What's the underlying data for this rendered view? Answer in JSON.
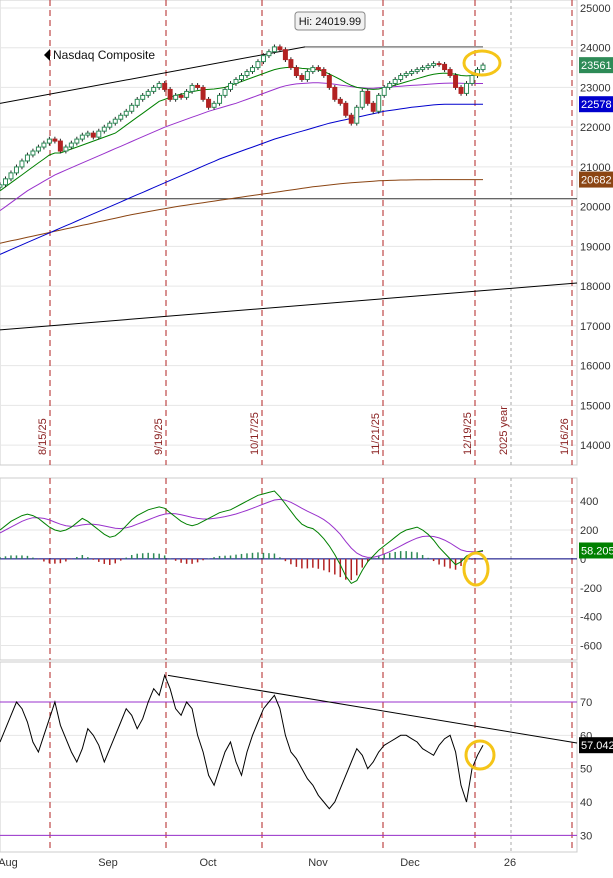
{
  "title": "Nasdaq Composite",
  "high_label": "Hi: 24019.99",
  "colors": {
    "price_line": "#000000",
    "sma20": "#008000",
    "sma50": "#9932cc",
    "sma100": "#0000cd",
    "sma200": "#8b4513",
    "vline": "#b22222",
    "highlight": "#f5c518",
    "up_candle": "#2e8b57",
    "down_candle": "#b22222",
    "macd": "#008000",
    "signal": "#9932cc",
    "rsi": "#000000",
    "rsi_band": "#9932cc"
  },
  "chart_data": [
    {
      "type": "line",
      "name": "price-panel",
      "y_ticks": [
        14000,
        15000,
        16000,
        17000,
        18000,
        19000,
        20000,
        21000,
        22000,
        23000,
        24000,
        25000
      ],
      "ylim": [
        13500,
        25200
      ],
      "value_badges": [
        {
          "value": "23561",
          "color": "#2e8b57"
        },
        {
          "value": "22578",
          "color": "#0000cd"
        },
        {
          "value": "20682",
          "color": "#8b4513"
        }
      ],
      "vertical_dates": [
        "8/15/25",
        "9/19/25",
        "10/17/25",
        "11/21/25",
        "12/19/25",
        "2025 year",
        "1/16/26"
      ],
      "series": [
        {
          "key": "close",
          "values": [
            20550,
            20700,
            20850,
            21000,
            21150,
            21300,
            21400,
            21500,
            21600,
            21700,
            21650,
            21400,
            21500,
            21600,
            21700,
            21800,
            21850,
            21750,
            21900,
            22000,
            22100,
            22200,
            22300,
            22400,
            22550,
            22700,
            22800,
            22900,
            23000,
            23100,
            22950,
            22700,
            22800,
            22750,
            22900,
            23050,
            23000,
            22700,
            22500,
            22600,
            22800,
            22950,
            23100,
            23200,
            23300,
            23400,
            23500,
            23650,
            23800,
            23900,
            24020,
            23950,
            23700,
            23500,
            23300,
            23200,
            23400,
            23500,
            23450,
            23300,
            23000,
            22700,
            22600,
            22300,
            22100,
            22500,
            22900,
            22600,
            22400,
            22800,
            23000,
            23100,
            23200,
            23300,
            23350,
            23400,
            23450,
            23500,
            23550,
            23600,
            23580,
            23450,
            23300,
            23000,
            22850,
            23100,
            23300,
            23450,
            23561
          ]
        },
        {
          "key": "sma20",
          "values": [
            20400,
            20500,
            20600,
            20700,
            20800,
            20900,
            21000,
            21100,
            21200,
            21300,
            21350,
            21350,
            21400,
            21450,
            21500,
            21550,
            21600,
            21650,
            21700,
            21750,
            21800,
            21850,
            21950,
            22050,
            22150,
            22250,
            22350,
            22450,
            22550,
            22650,
            22700,
            22750,
            22800,
            22830,
            22860,
            22890,
            22920,
            22940,
            22950,
            22960,
            22980,
            23000,
            23050,
            23100,
            23150,
            23200,
            23250,
            23300,
            23350,
            23400,
            23450,
            23480,
            23500,
            23510,
            23500,
            23480,
            23470,
            23460,
            23440,
            23400,
            23340,
            23270,
            23200,
            23120,
            23050,
            23000,
            22980,
            22960,
            22950,
            22960,
            22990,
            23020,
            23060,
            23100,
            23140,
            23180,
            23220,
            23260,
            23300,
            23330,
            23350,
            23360,
            23350,
            23330,
            23300,
            23290,
            23300,
            23320,
            23340
          ]
        },
        {
          "key": "sma50",
          "values": [
            19900,
            20000,
            20100,
            20200,
            20300,
            20400,
            20480,
            20560,
            20640,
            20720,
            20800,
            20860,
            20920,
            20980,
            21040,
            21100,
            21160,
            21220,
            21280,
            21340,
            21400,
            21460,
            21520,
            21580,
            21640,
            21700,
            21760,
            21820,
            21880,
            21940,
            22000,
            22050,
            22100,
            22150,
            22200,
            22250,
            22300,
            22350,
            22400,
            22440,
            22480,
            22520,
            22560,
            22600,
            22650,
            22700,
            22750,
            22800,
            22850,
            22900,
            22950,
            23000,
            23040,
            23070,
            23090,
            23100,
            23110,
            23120,
            23120,
            23110,
            23100,
            23080,
            23060,
            23040,
            23020,
            23000,
            22990,
            22980,
            22980,
            22990,
            23000,
            23010,
            23020,
            23030,
            23040,
            23050,
            23060,
            23070,
            23080,
            23090,
            23100,
            23105,
            23110,
            23110,
            23105,
            23100,
            23100,
            23100,
            23100
          ]
        },
        {
          "key": "sma100",
          "values": [
            18800,
            18860,
            18920,
            18980,
            19040,
            19100,
            19160,
            19220,
            19280,
            19340,
            19400,
            19460,
            19520,
            19580,
            19640,
            19700,
            19760,
            19820,
            19880,
            19940,
            20000,
            20060,
            20120,
            20180,
            20240,
            20300,
            20360,
            20420,
            20480,
            20540,
            20600,
            20660,
            20720,
            20780,
            20840,
            20900,
            20960,
            21020,
            21080,
            21140,
            21200,
            21250,
            21300,
            21350,
            21400,
            21450,
            21500,
            21550,
            21600,
            21650,
            21700,
            21740,
            21780,
            21820,
            21860,
            21900,
            21940,
            21980,
            22020,
            22060,
            22100,
            22130,
            22160,
            22190,
            22220,
            22250,
            22280,
            22310,
            22340,
            22370,
            22400,
            22420,
            22440,
            22460,
            22480,
            22500,
            22515,
            22530,
            22545,
            22560,
            22570,
            22575,
            22578,
            22578,
            22578,
            22578,
            22578,
            22578,
            22578
          ]
        },
        {
          "key": "sma200",
          "values": [
            19080,
            19110,
            19140,
            19170,
            19200,
            19230,
            19260,
            19290,
            19320,
            19350,
            19380,
            19410,
            19440,
            19470,
            19500,
            19530,
            19560,
            19590,
            19620,
            19650,
            19680,
            19710,
            19740,
            19770,
            19800,
            19825,
            19850,
            19875,
            19900,
            19925,
            19950,
            19975,
            20000,
            20020,
            20040,
            20060,
            20080,
            20100,
            20120,
            20140,
            20160,
            20180,
            20200,
            20220,
            20240,
            20260,
            20280,
            20300,
            20320,
            20340,
            20360,
            20380,
            20400,
            20420,
            20440,
            20460,
            20480,
            20500,
            20515,
            20530,
            20545,
            20560,
            20575,
            20590,
            20600,
            20610,
            20620,
            20630,
            20640,
            20650,
            20655,
            20660,
            20665,
            20670,
            20672,
            20674,
            20676,
            20678,
            20679,
            20680,
            20681,
            20682,
            20682,
            20682,
            20682,
            20682,
            20682,
            20682,
            20682
          ]
        }
      ]
    },
    {
      "type": "line",
      "name": "macd-panel",
      "y_ticks": [
        -600,
        -400,
        -200,
        0,
        200,
        400
      ],
      "ylim": [
        -700,
        560
      ],
      "value_badges": [
        {
          "value": "58.205",
          "color": "#008000"
        }
      ],
      "series": [
        {
          "key": "macd",
          "values": [
            200,
            230,
            260,
            280,
            300,
            310,
            300,
            280,
            250,
            220,
            200,
            190,
            200,
            220,
            250,
            280,
            260,
            230,
            200,
            170,
            150,
            160,
            190,
            230,
            270,
            300,
            320,
            340,
            350,
            360,
            350,
            320,
            290,
            260,
            240,
            230,
            240,
            260,
            280,
            300,
            320,
            330,
            340,
            360,
            380,
            400,
            420,
            440,
            450,
            460,
            470,
            430,
            380,
            330,
            280,
            240,
            220,
            210,
            180,
            140,
            90,
            30,
            -40,
            -120,
            -170,
            -150,
            -80,
            -20,
            20,
            60,
            90,
            120,
            150,
            180,
            200,
            210,
            220,
            200,
            170,
            130,
            80,
            40,
            0,
            -40,
            -20,
            20,
            40,
            50,
            58
          ]
        },
        {
          "key": "signal",
          "values": [
            180,
            200,
            220,
            240,
            260,
            275,
            285,
            285,
            280,
            270,
            255,
            240,
            230,
            225,
            228,
            235,
            240,
            240,
            235,
            228,
            220,
            212,
            210,
            215,
            225,
            240,
            255,
            270,
            285,
            300,
            310,
            314,
            312,
            305,
            297,
            287,
            280,
            276,
            276,
            280,
            286,
            293,
            301,
            311,
            323,
            336,
            350,
            365,
            380,
            394,
            408,
            412,
            406,
            392,
            372,
            350,
            330,
            312,
            294,
            272,
            244,
            210,
            170,
            120,
            75,
            40,
            20,
            10,
            12,
            20,
            34,
            50,
            70,
            90,
            110,
            128,
            144,
            155,
            158,
            155,
            145,
            130,
            110,
            85,
            62,
            52,
            50,
            50,
            52
          ]
        },
        {
          "key": "histogram",
          "values": [
            20,
            30,
            40,
            40,
            40,
            35,
            15,
            -5,
            -30,
            -50,
            -55,
            -50,
            -30,
            -5,
            22,
            45,
            20,
            -10,
            -35,
            -58,
            -70,
            -52,
            -20,
            15,
            45,
            60,
            65,
            70,
            65,
            60,
            40,
            6,
            -22,
            -45,
            -57,
            -57,
            -40,
            -16,
            4,
            20,
            34,
            37,
            39,
            49,
            57,
            64,
            70,
            75,
            70,
            66,
            62,
            18,
            -26,
            -62,
            -92,
            -110,
            -110,
            -102,
            -114,
            -132,
            -154,
            -180,
            -210,
            -240,
            -245,
            -190,
            -100,
            -30,
            8,
            40,
            56,
            70,
            80,
            90,
            90,
            82,
            76,
            45,
            12,
            -25,
            -65,
            -90,
            -110,
            -125,
            -82,
            -32,
            -10,
            0,
            6
          ]
        }
      ]
    },
    {
      "type": "line",
      "name": "rsi-panel",
      "y_ticks": [
        30,
        40,
        50,
        60,
        70
      ],
      "ylim": [
        25,
        82
      ],
      "value_badges": [
        {
          "value": "57.042",
          "color": "#000000"
        }
      ],
      "x_labels": [
        "Aug",
        "Sep",
        "Oct",
        "Nov",
        "Dec",
        "26"
      ],
      "series": [
        {
          "key": "rsi",
          "values": [
            58,
            62,
            66,
            70,
            68,
            64,
            58,
            55,
            60,
            65,
            70,
            63,
            59,
            55,
            52,
            56,
            62,
            60,
            57,
            52,
            56,
            60,
            64,
            68,
            66,
            62,
            65,
            70,
            74,
            72,
            78,
            74,
            68,
            66,
            70,
            68,
            60,
            55,
            48,
            45,
            50,
            55,
            58,
            52,
            48,
            55,
            60,
            64,
            68,
            70,
            72,
            68,
            60,
            55,
            53,
            50,
            47,
            45,
            42,
            40,
            38,
            40,
            44,
            48,
            52,
            56,
            54,
            50,
            52,
            55,
            57,
            58,
            59,
            60,
            60,
            59,
            58,
            56,
            55,
            54,
            57,
            59,
            60,
            55,
            45,
            40,
            50,
            54,
            57
          ]
        },
        {
          "key": "trendline",
          "values": [
            null,
            null,
            null,
            null,
            null,
            null,
            null,
            null,
            null,
            null,
            null,
            null,
            null,
            null,
            null,
            null,
            null,
            null,
            null,
            null,
            null,
            null,
            null,
            null,
            null,
            null,
            null,
            null,
            null,
            null,
            78,
            77,
            76,
            75,
            74,
            73.5,
            73,
            72.5,
            72,
            71.5,
            71,
            70.5,
            70,
            69.5,
            69,
            68.5,
            68,
            67.5,
            67,
            66.5,
            66,
            65.5,
            65,
            64.5,
            64,
            63.5,
            63,
            62.5,
            62,
            61.8,
            61.5,
            61.2,
            61,
            60.8,
            60.5,
            60.2,
            60,
            59.8,
            59.6,
            59.4,
            59.2,
            59,
            58.8,
            58.6,
            58.4,
            58.2,
            58,
            57.8,
            57.6,
            57.5,
            57.3,
            57.2,
            57.1,
            57.05,
            57.03,
            57.03,
            57.03,
            57.03,
            57.042
          ]
        }
      ]
    }
  ]
}
